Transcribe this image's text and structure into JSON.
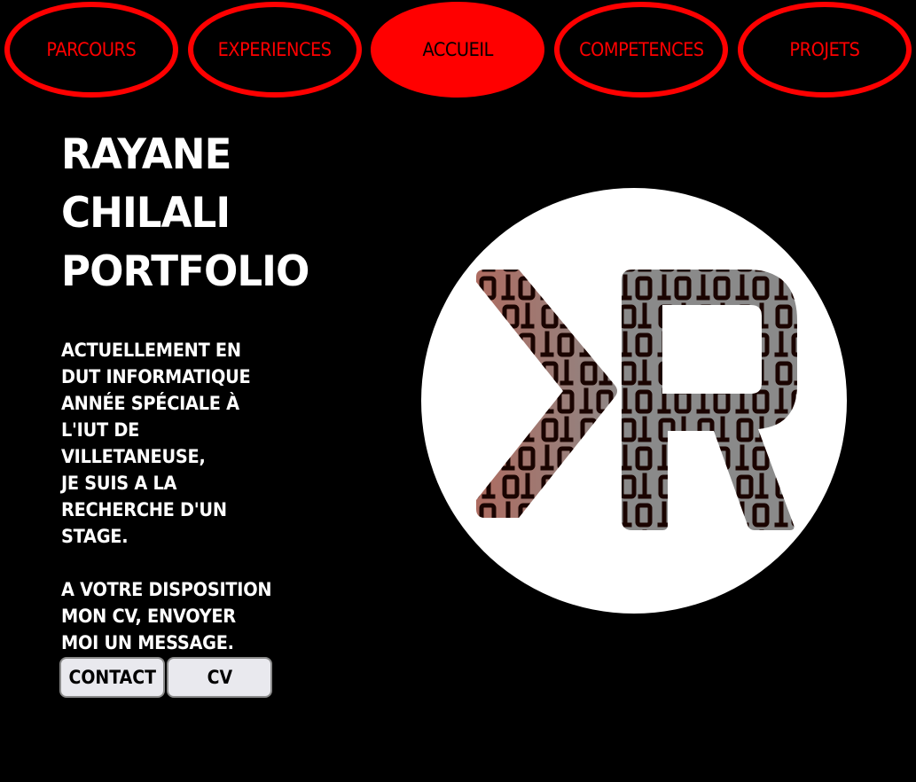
{
  "nav": {
    "items": [
      {
        "label": "PARCOURS"
      },
      {
        "label": "EXPERIENCES"
      },
      {
        "label": "ACCUEIL"
      },
      {
        "label": "COMPETENCES"
      },
      {
        "label": "PROJETS"
      }
    ],
    "active": "ACCUEIL"
  },
  "hero": {
    "title_lines": [
      "RAYANE",
      "CHILALI",
      "PORTFOLIO"
    ],
    "bio_lines": [
      "ACTUELLEMENT EN",
      "DUT INFORMATIQUE",
      "ANNÉE SPÉCIALE À",
      "L'IUT DE",
      "VILLETANEUSE,",
      "JE SUIS A LA",
      "RECHERCHE D'UN",
      "STAGE."
    ],
    "cta_lines": [
      "A VOTRE DISPOSITION",
      "MON CV, ENVOYER",
      "MOI UN MESSAGE."
    ]
  },
  "buttons": {
    "contact": "CONTACT",
    "cv": "CV"
  },
  "logo": {
    "icon": "rc-monogram-logo",
    "binary_pattern": "1 0 1 0 0 1 1 0 1 0 0 1 1 0"
  },
  "colors": {
    "accent": "#ff0000",
    "background": "#000000",
    "text": "#ffffff"
  }
}
